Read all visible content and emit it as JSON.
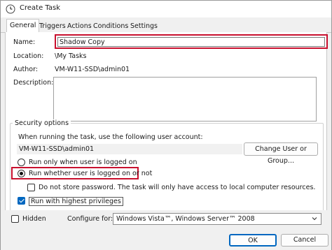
{
  "window": {
    "title": "Create Task"
  },
  "tabs": [
    {
      "label": "General",
      "active": true
    },
    {
      "label": "Triggers",
      "active": false
    },
    {
      "label": "Actions",
      "active": false
    },
    {
      "label": "Conditions",
      "active": false
    },
    {
      "label": "Settings",
      "active": false
    }
  ],
  "general": {
    "name_label": "Name:",
    "name_value": "Shadow Copy",
    "location_label": "Location:",
    "location_value": "\\My Tasks",
    "author_label": "Author:",
    "author_value": "VM-W11-SSD\\admin01",
    "description_label": "Description:",
    "description_value": ""
  },
  "security": {
    "group_title": "Security options",
    "account_prompt": "When running the task, use the following user account:",
    "account_value": "VM-W11-SSD\\admin01",
    "change_button": "Change User or Group...",
    "radio_logged_on": "Run only when user is logged on",
    "radio_whether": "Run whether user is logged on or not",
    "selected_radio": "whether",
    "no_store_password": "Do not store password.  The task will only have access to local computer resources.",
    "no_store_password_checked": false,
    "highest_privileges": "Run with highest privileges",
    "highest_privileges_checked": true
  },
  "footer": {
    "hidden_label": "Hidden",
    "hidden_checked": false,
    "configure_label": "Configure for:",
    "configure_value": "Windows Vista™, Windows Server™ 2008",
    "ok_button": "OK",
    "cancel_button": "Cancel"
  },
  "colors": {
    "highlight": "#c8102e",
    "accent": "#0067c0"
  },
  "icons": {
    "title": "task-scheduler-icon",
    "combo": "chevron-down-icon"
  }
}
